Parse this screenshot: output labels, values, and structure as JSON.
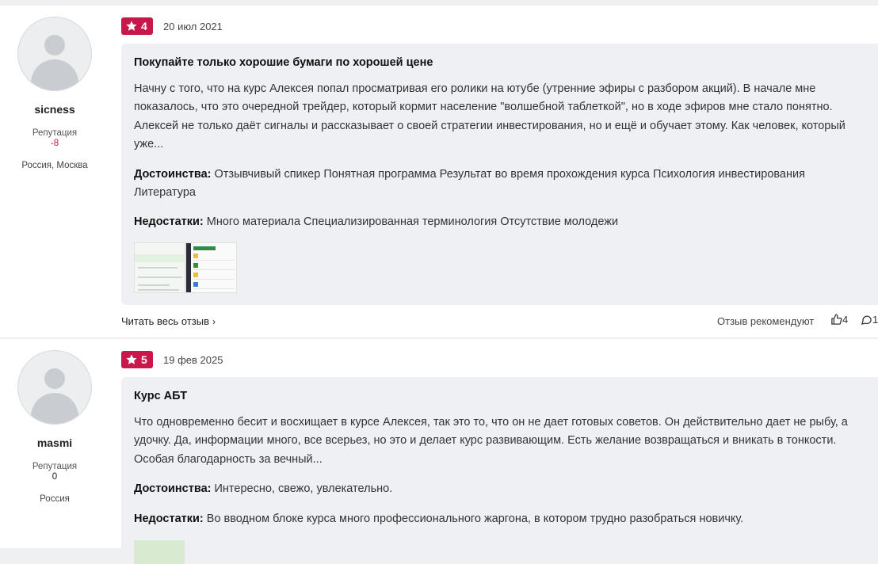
{
  "reviews": [
    {
      "author": {
        "name": "sicness",
        "reputation_label": "Репутация",
        "reputation_value": "-8",
        "location": "Россия, Москва"
      },
      "rating": "4",
      "date": "20 июл 2021",
      "title": "Покупайте только хорошие бумаги по хорошей цене",
      "body": "Начну с того, что на курс Алексея попал просматривая его ролики на ютубе (утренние эфиры с разбором акций). В начале мне показалось, что это очередной трейдер, который кормит население \"волшебной таблеткой\", но в ходе эфиров мне стало понятно. Алексей не только даёт сигналы и рассказывает о своей стратегии инвестирования, но и ещё и обучает этому. Как человек, который уже...",
      "pros_label": "Достоинства:",
      "pros": "Отзывчивый спикер Понятная программа Результат во время прохождения курса Психология инвестирования Литература",
      "cons_label": "Недостатки:",
      "cons": "Много материала Специализированная терминология Отсутствие молодежи",
      "read_more": "Читать весь отзыв",
      "recommend": "Отзыв рекомендуют",
      "likes": "4",
      "comments": "1"
    },
    {
      "author": {
        "name": "masmi",
        "reputation_label": "Репутация",
        "reputation_value": "0",
        "location": "Россия"
      },
      "rating": "5",
      "date": "19 фев 2025",
      "title": "Курс АБТ",
      "body": "Что одновременно бесит и восхищает в курсе Алексея, так это то, что он не дает готовых советов. Он действительно дает не рыбу, а удочку. Да, информации много, все всерьез, но это и делает курс развивающим. Есть желание возвращаться и вникать в тонкости. Особая благодарность за вечный...",
      "pros_label": "Достоинства:",
      "pros": "Интересно, свежо, увлекательно.",
      "cons_label": "Недостатки:",
      "cons": "Во вводном блоке курса много профессионального жаргона, в котором трудно разобраться новичку."
    }
  ],
  "colors": {
    "accent": "#c8174b",
    "content_bg": "#eef0f3"
  },
  "icons": {
    "rating": "star-icon",
    "read_more": "chevron-right-icon",
    "likes": "thumbs-up-icon",
    "comments": "comment-icon"
  }
}
